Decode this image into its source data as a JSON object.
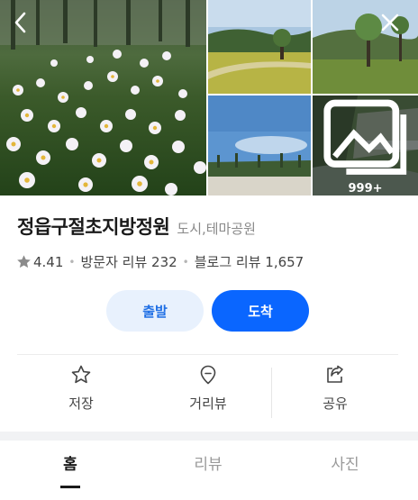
{
  "gallery": {
    "more_count": "999+",
    "icons": {
      "back": "chevron-left-icon",
      "close": "close-icon",
      "photos": "photo-stack-icon"
    }
  },
  "place": {
    "name": "정읍구절초지방정원",
    "category": "도시,테마공원"
  },
  "stats": {
    "rating": "4.41",
    "visitor_reviews": "방문자 리뷰 232",
    "blog_reviews": "블로그 리뷰 1,657"
  },
  "route": {
    "depart_label": "출발",
    "arrive_label": "도착",
    "depart_color": "#e8f1fd",
    "arrive_color": "#0a66ff"
  },
  "actions": {
    "save": "저장",
    "roadview": "거리뷰",
    "share": "공유"
  },
  "tabs": [
    {
      "label": "홈",
      "active": true
    },
    {
      "label": "리뷰",
      "active": false
    },
    {
      "label": "사진",
      "active": false
    }
  ]
}
